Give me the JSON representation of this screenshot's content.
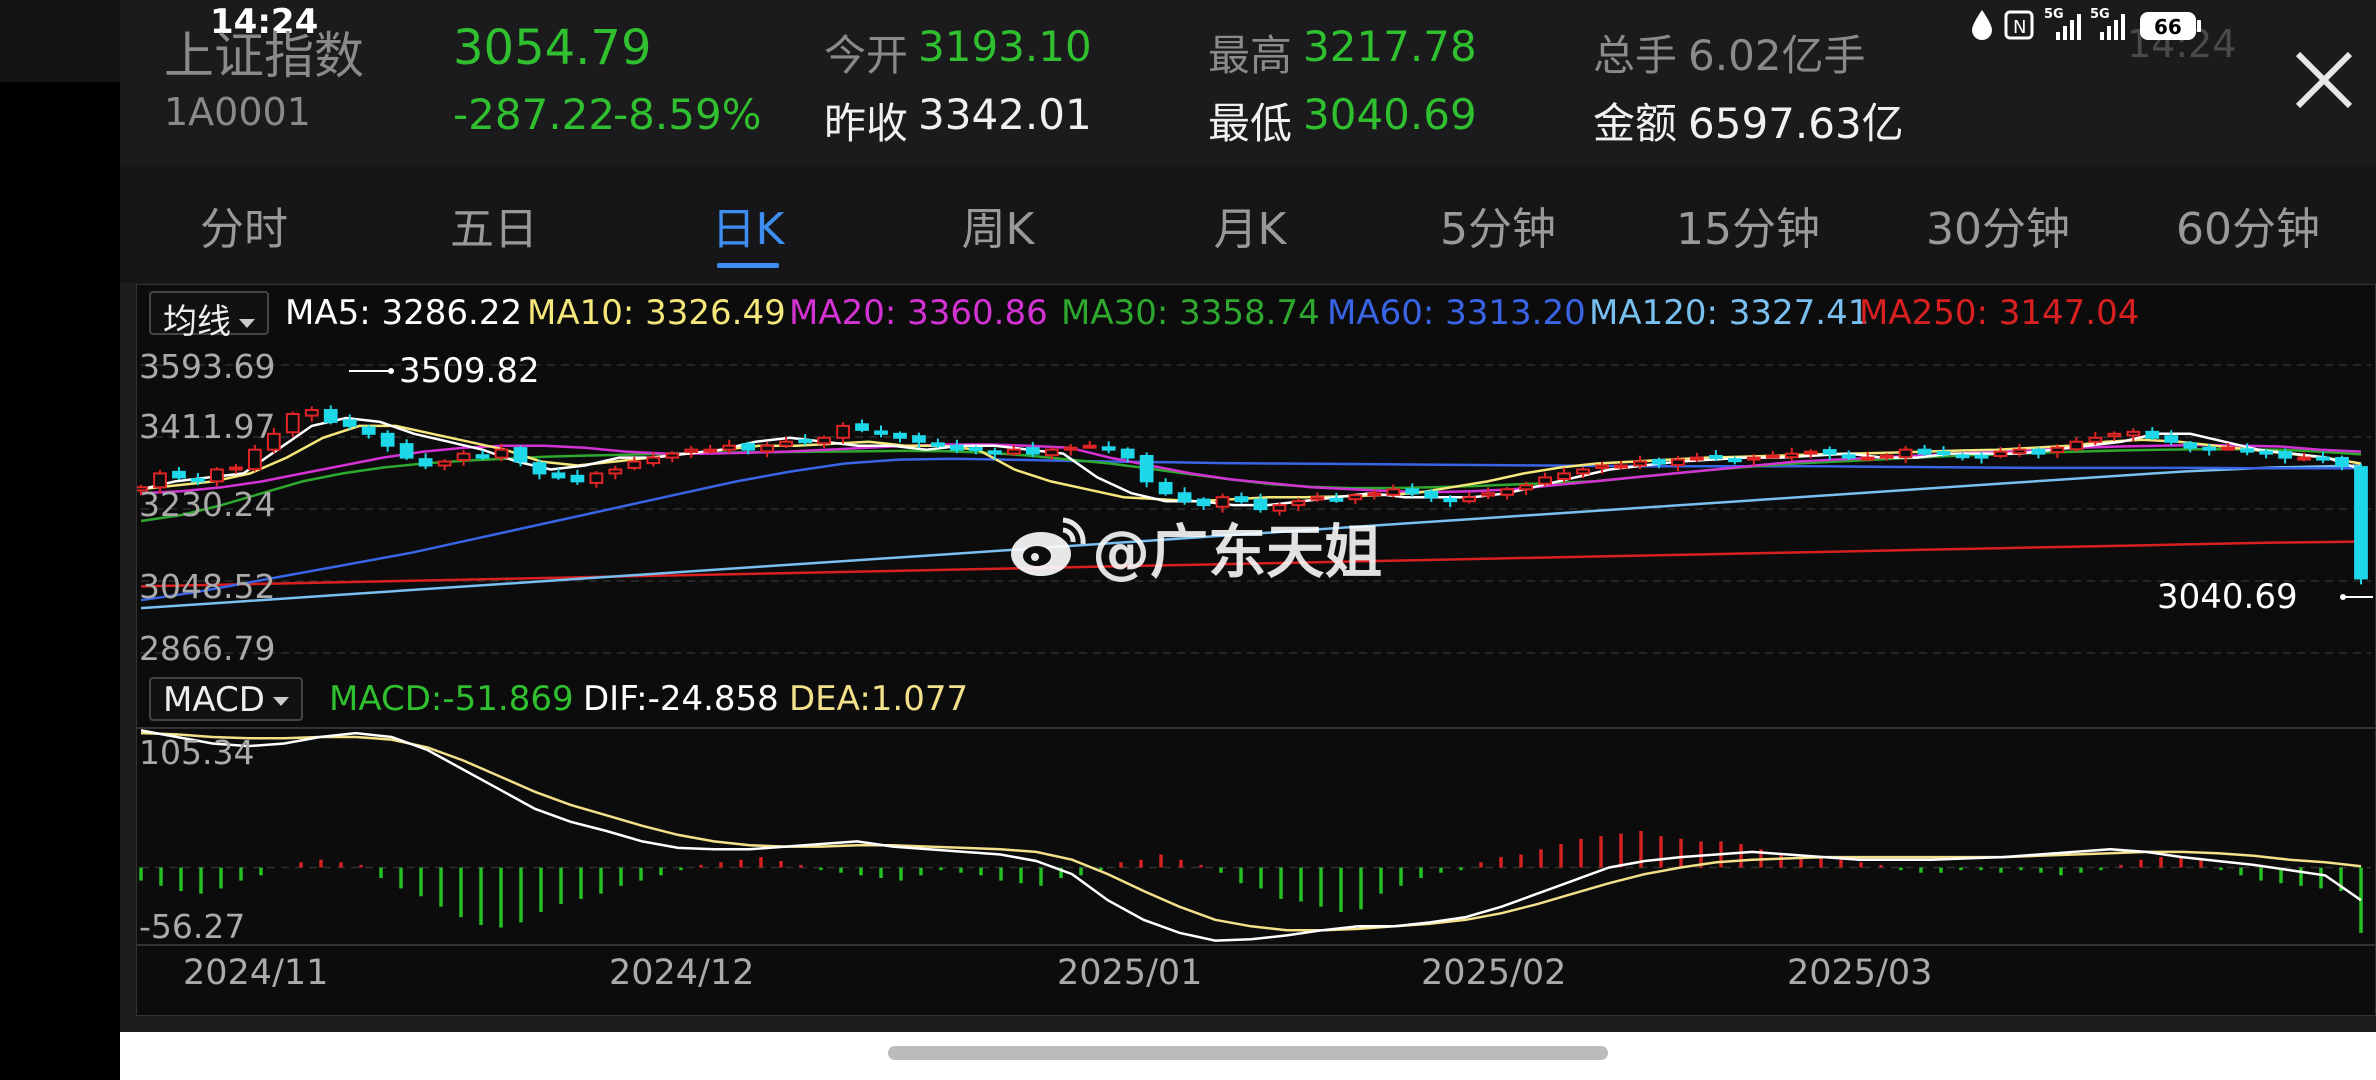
{
  "status": {
    "time": "14:24",
    "time_right": "14:24",
    "network1": "5G",
    "network2": "5G",
    "battery": "66"
  },
  "quote": {
    "name": "上证指数",
    "code": "1A0001",
    "price": "3054.79",
    "change": "-287.22",
    "change_pct": "-8.59%",
    "open_label": "今开",
    "open": "3193.10",
    "prev_close_label": "昨收",
    "prev_close": "3342.01",
    "high_label": "最高",
    "high": "3217.78",
    "low_label": "最低",
    "low": "3040.69",
    "volume_label": "总手",
    "volume": "6.02亿手",
    "amount_label": "金额",
    "amount": "6597.63亿"
  },
  "tabs": [
    "分时",
    "五日",
    "日K",
    "周K",
    "月K",
    "5分钟",
    "15分钟",
    "30分钟",
    "60分钟"
  ],
  "active_tab": "日K",
  "colors": {
    "up": "#e02525",
    "down": "#1ed7e8",
    "ma5": "#ffffff",
    "ma10": "#f5e77a",
    "ma20": "#d433d4",
    "ma30": "#2fa82f",
    "ma60": "#3a64e6",
    "ma120": "#79bff0",
    "ma250": "#d92020",
    "dif": "#ffffff",
    "dea": "#f3e08a",
    "macd_pos": "#d42020",
    "macd_neg": "#24c024"
  },
  "ma_legend": {
    "selector": "均线",
    "ma5": "MA5: 3286.22",
    "ma10": "MA10: 3326.49",
    "ma20": "MA20: 3360.86",
    "ma30": "MA30: 3358.74",
    "ma60": "MA60: 3313.20",
    "ma120": "MA120: 3327.41",
    "ma250": "MA250: 3147.04"
  },
  "macd_legend": {
    "selector": "MACD",
    "macd": "MACD:-51.869",
    "dif": "DIF:-24.858",
    "dea": "DEA:1.077"
  },
  "watermark": "@广东天姐",
  "chart_data": [
    {
      "type": "candlestick",
      "y_axis_labels": [
        "3593.69",
        "3411.97",
        "3230.24",
        "3048.52",
        "2866.79"
      ],
      "ylim": [
        2866.79,
        3593.69
      ],
      "x_tick_labels": [
        "2024/11",
        "2024/12",
        "2025/01",
        "2025/02",
        "2025/03"
      ],
      "high_marker": "3509.82",
      "low_marker": "3040.69",
      "grid": true,
      "candles_close": [
        3285,
        3320,
        3310,
        3300,
        3330,
        3335,
        3380,
        3420,
        3470,
        3480,
        3450,
        3440,
        3420,
        3390,
        3360,
        3340,
        3350,
        3370,
        3360,
        3380,
        3350,
        3320,
        3310,
        3300,
        3320,
        3330,
        3350,
        3360,
        3370,
        3380,
        3380,
        3390,
        3380,
        3390,
        3400,
        3400,
        3410,
        3440,
        3430,
        3420,
        3410,
        3400,
        3390,
        3380,
        3380,
        3370,
        3380,
        3370,
        3380,
        3385,
        3390,
        3380,
        3360,
        3300,
        3270,
        3250,
        3240,
        3260,
        3250,
        3230,
        3240,
        3250,
        3260,
        3255,
        3265,
        3270,
        3280,
        3270,
        3260,
        3250,
        3260,
        3270,
        3280,
        3290,
        3310,
        3320,
        3330,
        3340,
        3340,
        3350,
        3345,
        3355,
        3360,
        3360,
        3355,
        3360,
        3365,
        3370,
        3375,
        3370,
        3360,
        3360,
        3365,
        3380,
        3370,
        3370,
        3365,
        3360,
        3375,
        3380,
        3370,
        3385,
        3400,
        3410,
        3420,
        3425,
        3410,
        3400,
        3385,
        3380,
        3385,
        3375,
        3370,
        3360,
        3360,
        3355,
        3340,
        3055
      ],
      "series": [
        {
          "name": "MA5",
          "values": [
            3280,
            3300,
            3310,
            3320,
            3380,
            3440,
            3460,
            3450,
            3420,
            3400,
            3380,
            3350,
            3330,
            3340,
            3360,
            3360,
            3370,
            3380,
            3400,
            3410,
            3400,
            3390,
            3390,
            3380,
            3390,
            3390,
            3380,
            3370,
            3310,
            3270,
            3250,
            3250,
            3240,
            3240,
            3250,
            3260,
            3270,
            3260,
            3260,
            3260,
            3270,
            3290,
            3310,
            3330,
            3340,
            3350,
            3355,
            3360,
            3360,
            3365,
            3370,
            3360,
            3360,
            3370,
            3370,
            3370,
            3380,
            3390,
            3400,
            3420,
            3420,
            3400,
            3380,
            3370,
            3360,
            3330
          ]
        },
        {
          "name": "MA10",
          "values": [
            3280,
            3290,
            3300,
            3320,
            3360,
            3410,
            3440,
            3440,
            3420,
            3400,
            3380,
            3350,
            3340,
            3350,
            3360,
            3370,
            3380,
            3390,
            3390,
            3395,
            3400,
            3390,
            3390,
            3380,
            3330,
            3300,
            3280,
            3260,
            3255,
            3250,
            3255,
            3260,
            3260,
            3262,
            3265,
            3270,
            3285,
            3300,
            3320,
            3335,
            3345,
            3350,
            3355,
            3360,
            3362,
            3365,
            3368,
            3370,
            3372,
            3375,
            3378,
            3380,
            3385,
            3390,
            3400,
            3405,
            3400,
            3390,
            3380,
            3370,
            3360,
            3345
          ]
        },
        {
          "name": "MA20",
          "values": [
            3270,
            3275,
            3285,
            3300,
            3320,
            3340,
            3360,
            3375,
            3385,
            3390,
            3390,
            3385,
            3375,
            3370,
            3370,
            3372,
            3375,
            3380,
            3385,
            3390,
            3393,
            3393,
            3390,
            3385,
            3360,
            3340,
            3320,
            3305,
            3295,
            3285,
            3280,
            3275,
            3273,
            3275,
            3280,
            3290,
            3300,
            3310,
            3320,
            3330,
            3340,
            3350,
            3355,
            3360,
            3365,
            3370,
            3375,
            3380,
            3385,
            3388,
            3390,
            3392,
            3390,
            3388,
            3380,
            3375
          ]
        },
        {
          "name": "MA30",
          "values": [
            3200,
            3215,
            3240,
            3270,
            3300,
            3320,
            3335,
            3345,
            3352,
            3357,
            3362,
            3365,
            3367,
            3370,
            3372,
            3373,
            3374,
            3375,
            3376,
            3377,
            3376,
            3372,
            3365,
            3355,
            3345,
            3332,
            3318,
            3305,
            3293,
            3286,
            3283,
            3283,
            3285,
            3288,
            3292,
            3296,
            3300,
            3310,
            3320,
            3330,
            3338,
            3345,
            3350,
            3355,
            3360,
            3365,
            3368,
            3372,
            3375,
            3378,
            3380,
            3381,
            3381,
            3380,
            3375,
            3368
          ]
        },
        {
          "name": "MA60",
          "values": [
            3000,
            3020,
            3045,
            3070,
            3095,
            3120,
            3150,
            3180,
            3210,
            3240,
            3270,
            3300,
            3325,
            3345,
            3355,
            3357,
            3355,
            3352,
            3350,
            3348,
            3346,
            3345,
            3344,
            3343,
            3342,
            3341,
            3340,
            3339,
            3338,
            3338,
            3338,
            3338,
            3337,
            3336,
            3335,
            3334,
            3334,
            3334,
            3334,
            3333,
            3333,
            3333
          ]
        },
        {
          "name": "MA120",
          "values": [
            2980,
            2995,
            3010,
            3025,
            3040,
            3055,
            3070,
            3085,
            3100,
            3115,
            3130,
            3145,
            3160,
            3175,
            3190,
            3205,
            3220,
            3235,
            3250,
            3265,
            3280,
            3295,
            3310,
            3325,
            3335,
            3340
          ]
        },
        {
          "name": "MA250",
          "values": [
            3035,
            3040,
            3045,
            3050,
            3055,
            3060,
            3065,
            3070,
            3075,
            3080,
            3085,
            3090,
            3095,
            3100,
            3105,
            3110,
            3115,
            3120,
            3125,
            3130,
            3135,
            3140,
            3145,
            3148
          ]
        }
      ]
    },
    {
      "type": "macd",
      "y_axis_labels": [
        "105.34",
        "-56.27"
      ],
      "ylim": [
        -56.27,
        105.34
      ],
      "series": [
        {
          "name": "DIF",
          "values": [
            105,
            100,
            95,
            93,
            95,
            100,
            103,
            100,
            90,
            75,
            60,
            45,
            35,
            28,
            20,
            15,
            14,
            14,
            16,
            18,
            20,
            16,
            14,
            12,
            10,
            5,
            -5,
            -25,
            -40,
            -50,
            -56,
            -55,
            -52,
            -48,
            -45,
            -45,
            -42,
            -38,
            -30,
            -20,
            -10,
            0,
            5,
            8,
            10,
            12,
            10,
            8,
            6,
            6,
            6,
            7,
            8,
            10,
            12,
            14,
            12,
            8,
            5,
            2,
            -2,
            -6,
            -25
          ]
        },
        {
          "name": "DEA",
          "values": [
            103,
            102,
            100,
            99,
            99,
            100,
            100,
            98,
            92,
            82,
            70,
            58,
            48,
            40,
            32,
            25,
            20,
            17,
            16,
            16,
            17,
            17,
            16,
            15,
            14,
            12,
            6,
            -5,
            -18,
            -30,
            -40,
            -45,
            -48,
            -48,
            -47,
            -45,
            -43,
            -40,
            -35,
            -28,
            -20,
            -12,
            -5,
            0,
            4,
            6,
            7,
            8,
            8,
            8,
            8,
            8,
            8,
            9,
            10,
            11,
            12,
            12,
            11,
            9,
            6,
            4,
            1
          ]
        },
        {
          "name": "MACD",
          "values": [
            -10,
            -14,
            -18,
            -20,
            -16,
            -10,
            -6,
            0,
            4,
            6,
            4,
            2,
            -8,
            -16,
            -22,
            -30,
            -38,
            -44,
            -46,
            -42,
            -34,
            -28,
            -24,
            -20,
            -14,
            -10,
            -6,
            -2,
            2,
            4,
            6,
            8,
            5,
            2,
            -2,
            -4,
            -6,
            -8,
            -10,
            -6,
            -2,
            -4,
            -6,
            -10,
            -12,
            -14,
            -8,
            -6,
            -2,
            4,
            6,
            10,
            6,
            2,
            -4,
            -12,
            -16,
            -24,
            -26,
            -30,
            -34,
            -32,
            -20,
            -14,
            -8,
            -4,
            -2,
            4,
            8,
            10,
            14,
            18,
            22,
            24,
            26,
            28,
            24,
            22,
            20,
            20,
            18,
            14,
            10,
            8,
            8,
            6,
            4,
            2,
            -2,
            -4,
            -4,
            -2,
            -2,
            -4,
            -2,
            -4,
            -6,
            -4,
            -2,
            2,
            6,
            8,
            8,
            6,
            -2,
            -6,
            -10,
            -12,
            -14,
            -16,
            -18,
            -50
          ]
        }
      ]
    }
  ]
}
